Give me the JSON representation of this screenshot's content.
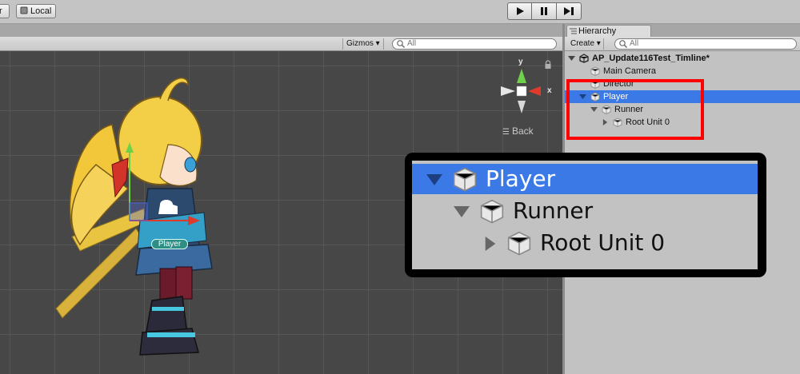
{
  "toolbar": {
    "pivot_label": "r",
    "local_label": "Local",
    "play_icon": "play-icon",
    "pause_icon": "pause-icon",
    "step_icon": "step-icon"
  },
  "scene": {
    "gizmos_label": "Gizmos",
    "search_placeholder": "All",
    "back_label": "Back",
    "axis_y": "y",
    "axis_x": "x",
    "player_tag": "Player"
  },
  "hierarchy": {
    "tab_label": "Hierarchy",
    "create_label": "Create",
    "search_placeholder": "All",
    "rows": [
      {
        "label": "AP_Update116Test_Timline*"
      },
      {
        "label": "Main Camera"
      },
      {
        "label": "Director"
      },
      {
        "label": "Player"
      },
      {
        "label": "Runner"
      },
      {
        "label": "Root Unit 0"
      }
    ],
    "selected": "Player"
  },
  "zoom": {
    "rows": [
      {
        "label": "Player"
      },
      {
        "label": "Runner"
      },
      {
        "label": "Root Unit 0"
      }
    ]
  },
  "colors": {
    "selection": "#3b79e6",
    "highlight_box": "#ff0000",
    "scene_bg": "#474747",
    "panel_bg": "#c2c2c2"
  }
}
